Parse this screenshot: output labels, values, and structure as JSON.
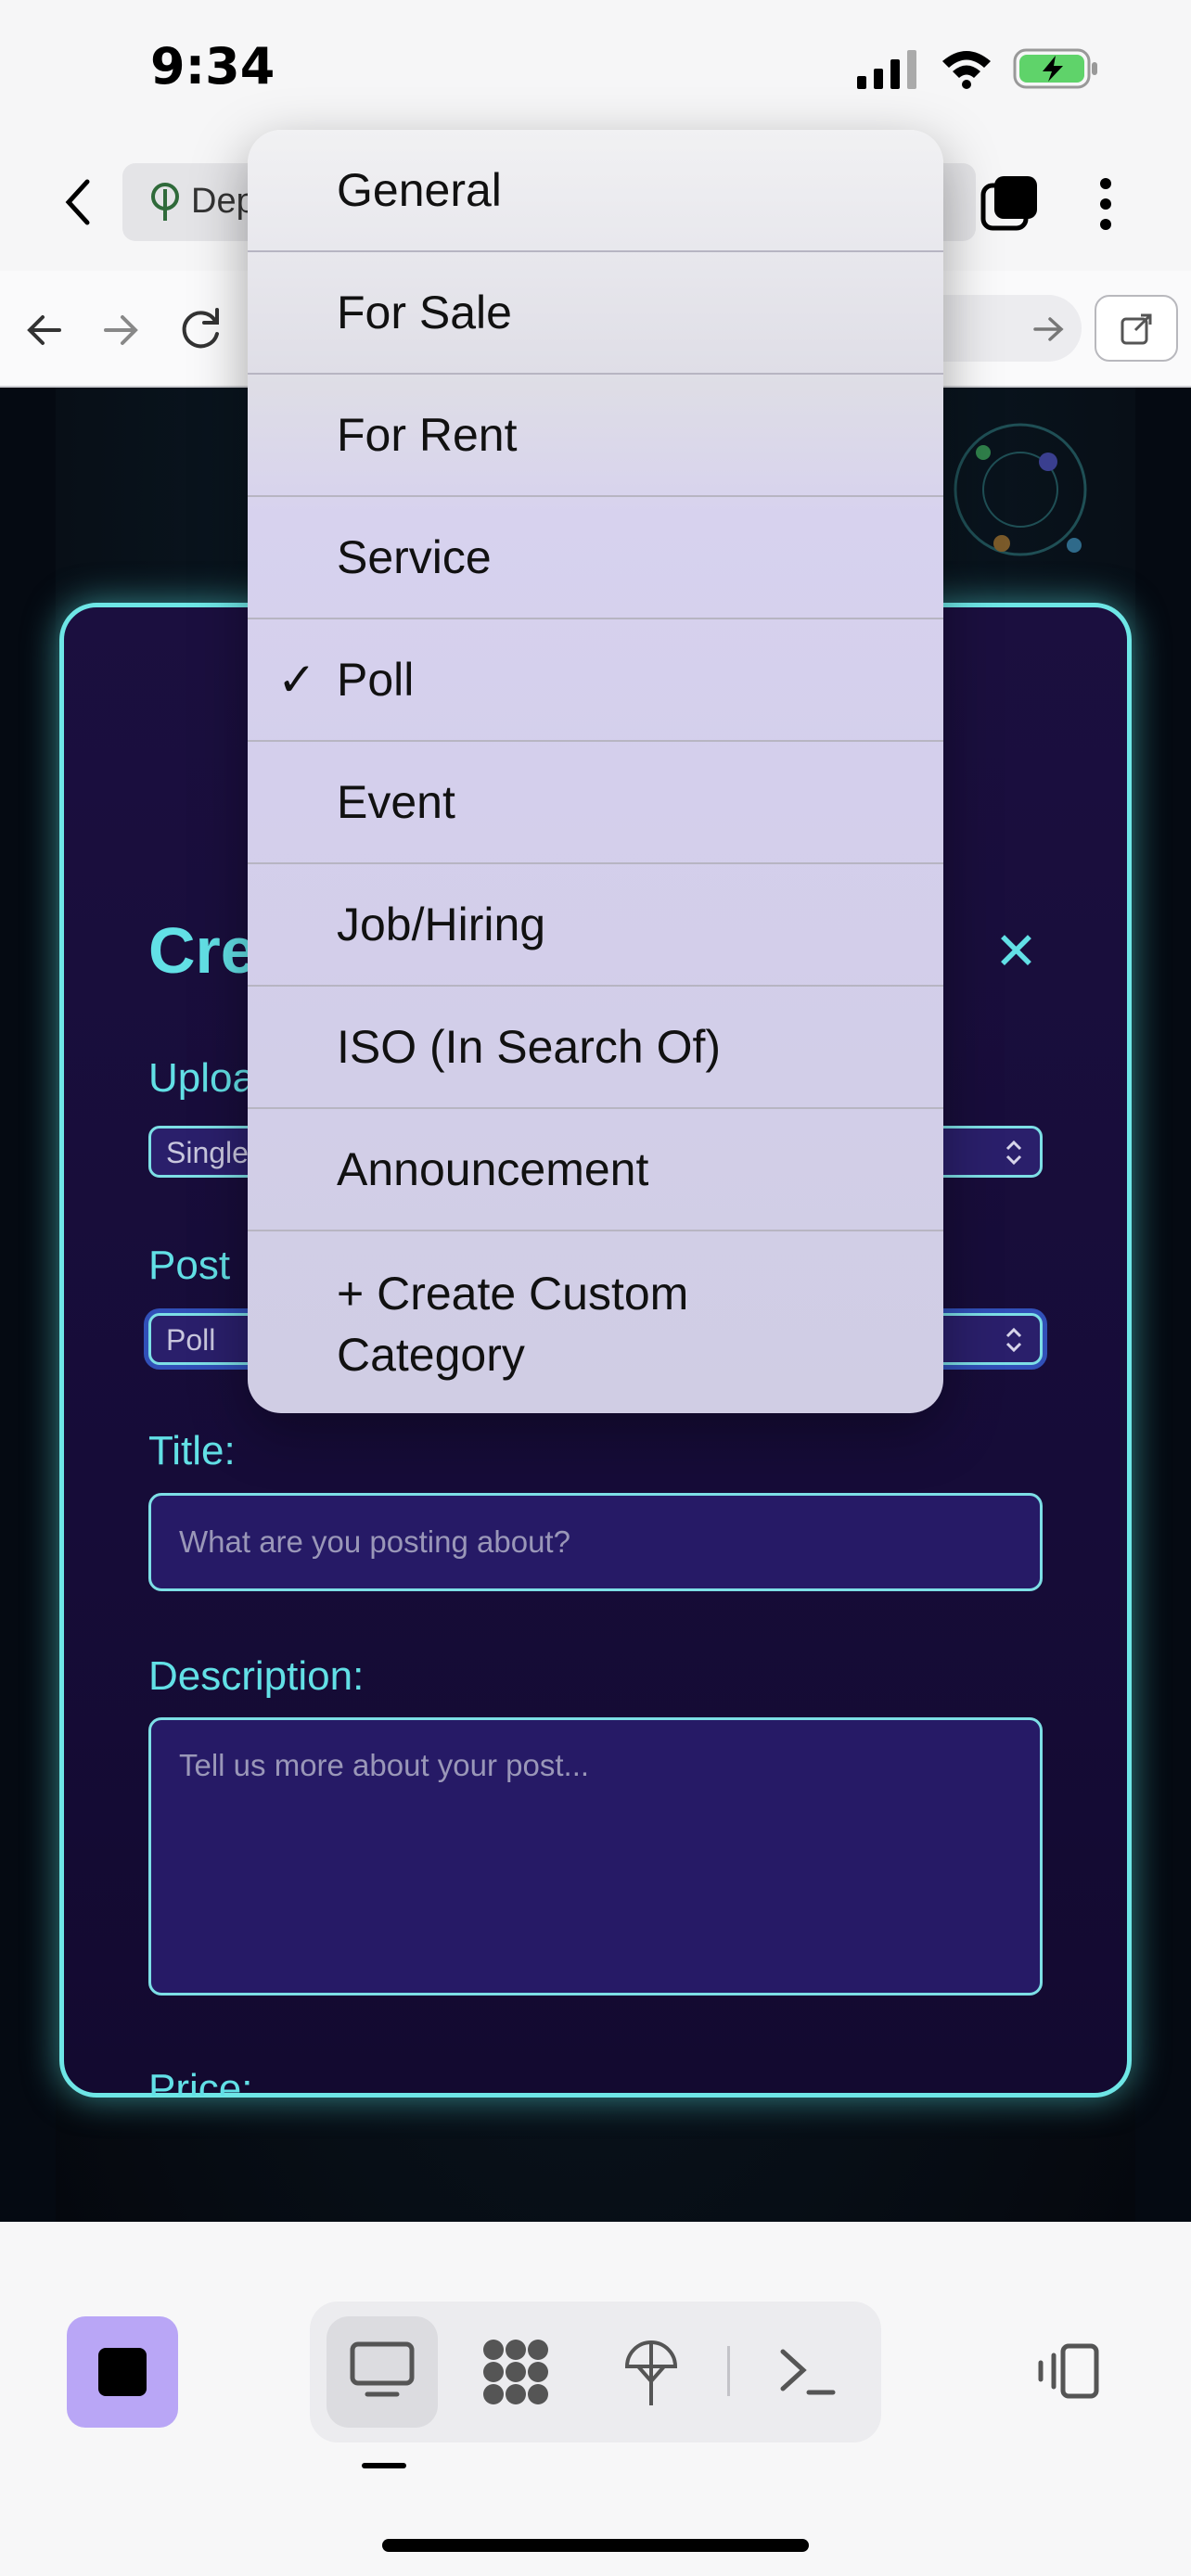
{
  "status_bar": {
    "time": "9:34",
    "icons": [
      "signal-icon",
      "wifi-icon",
      "battery-charging-icon"
    ]
  },
  "browser": {
    "tab_title_fragment": "Dep",
    "icons": [
      "back-chevron-icon",
      "site-icon",
      "tabs-icon",
      "more-vertical-icon",
      "back-arrow-icon",
      "forward-arrow-icon",
      "reload-icon",
      "go-arrow-icon",
      "open-external-icon"
    ]
  },
  "modal": {
    "title_fragment": "Cre",
    "close_symbol": "✕",
    "upload_label_fragment": "Uploa",
    "upload_value_fragment": "Single",
    "post_label_fragment": "Post",
    "post_value": "Poll",
    "title_label": "Title:",
    "title_placeholder": "What are you posting about?",
    "description_label": "Description:",
    "description_placeholder": "Tell us more about your post...",
    "price_label_fragment": "Price:"
  },
  "dropdown": {
    "selected_index": 4,
    "check_symbol": "✓",
    "items": [
      "General",
      "For Sale",
      "For Rent",
      "Service",
      "Poll",
      "Event",
      "Job/Hiring",
      "ISO (In Search Of)",
      "Announcement",
      "+ Create Custom Category"
    ]
  },
  "bottom_bar": {
    "icons": [
      "stop-icon",
      "desktop-icon",
      "apps-grid-icon",
      "network-icon",
      "terminal-icon",
      "side-panel-icon"
    ]
  }
}
